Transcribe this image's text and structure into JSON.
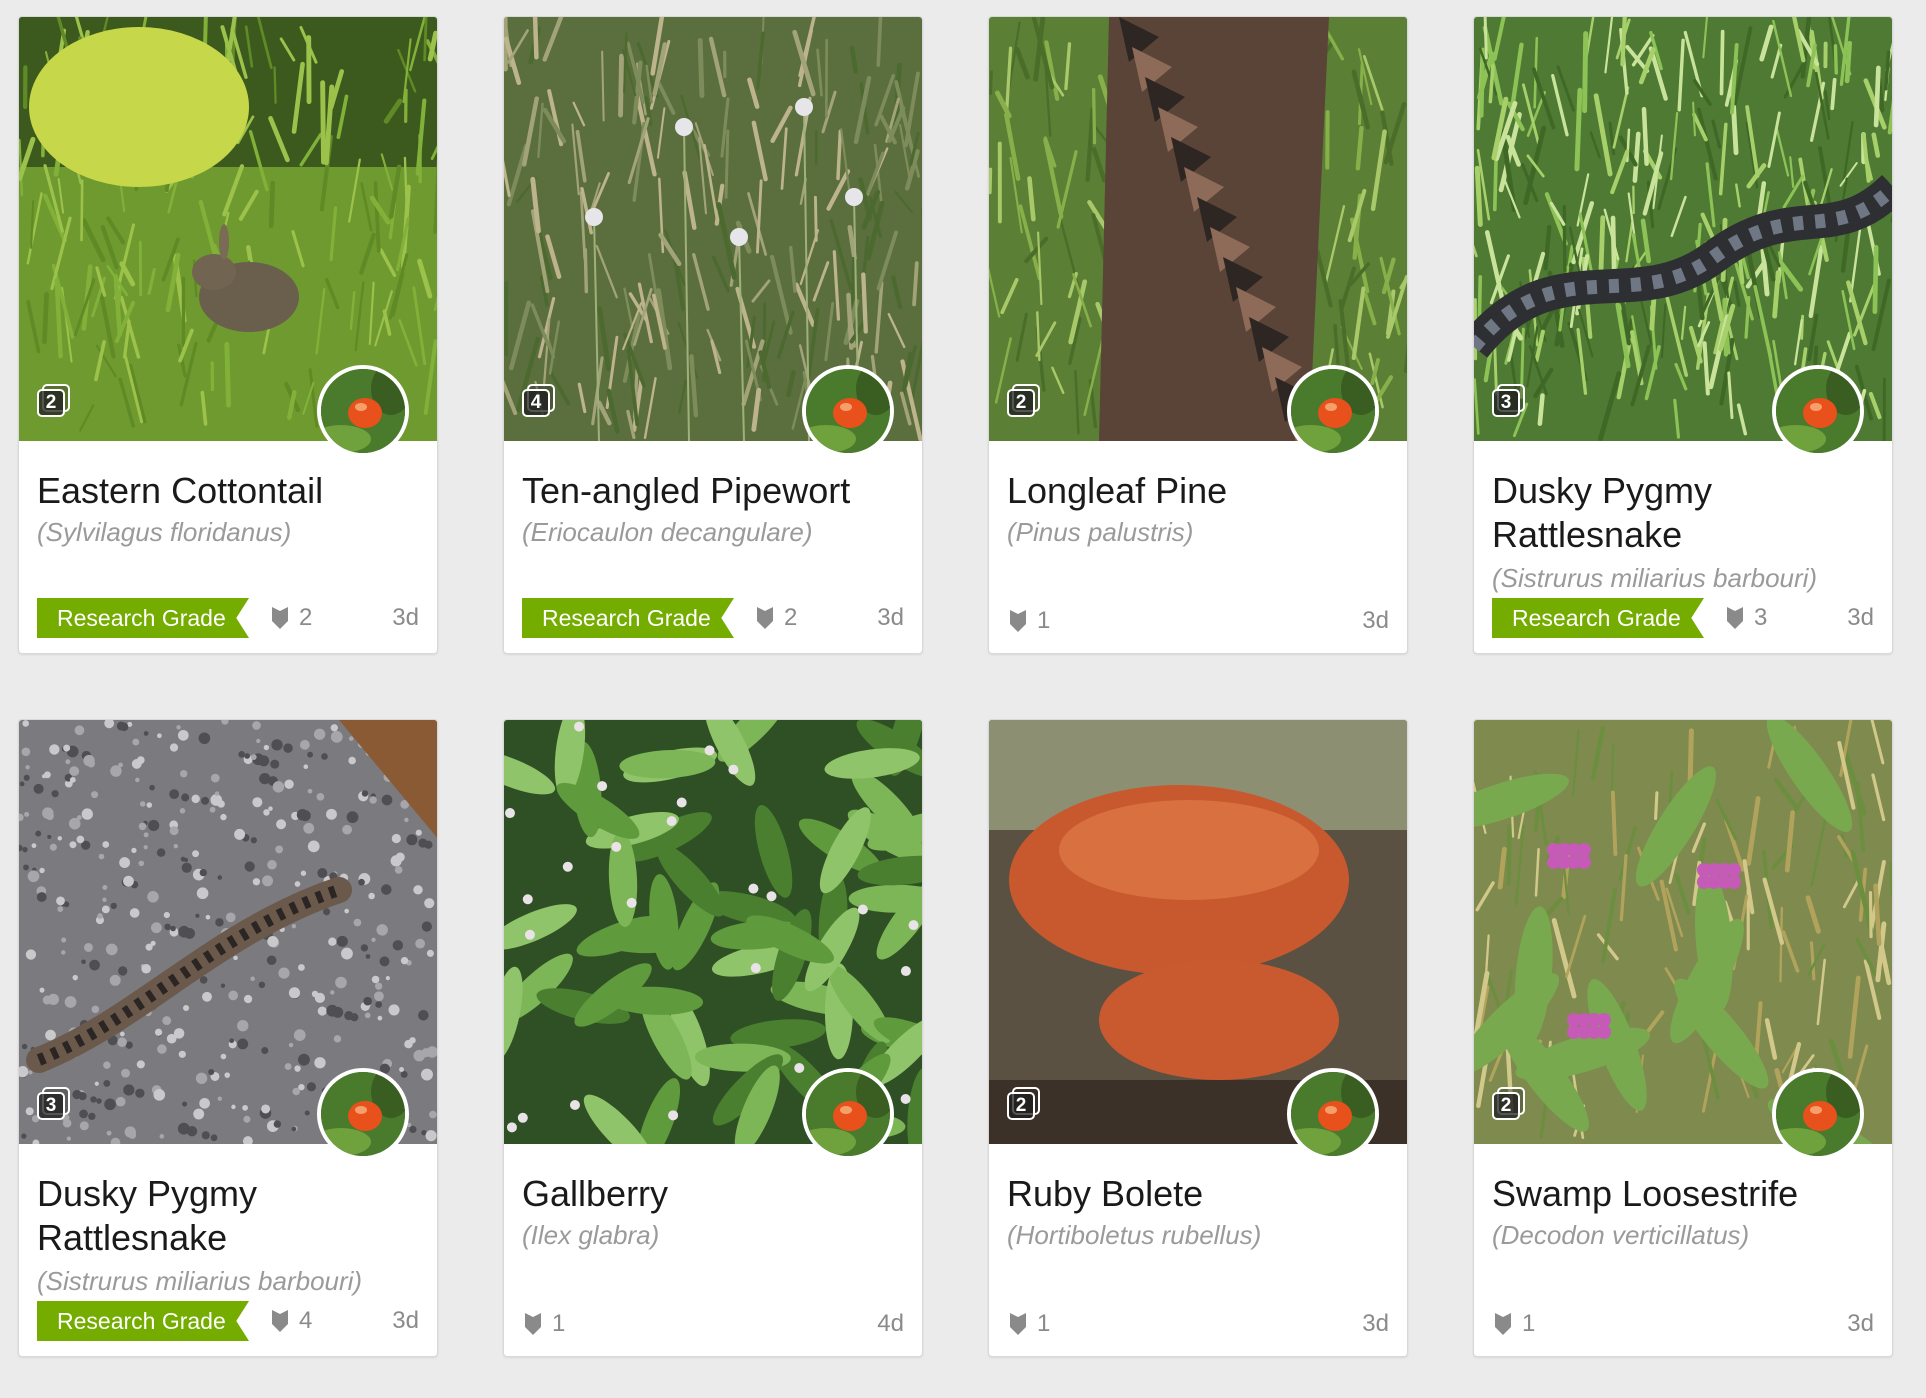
{
  "colors": {
    "research_grade": "#74ac00",
    "background": "#ebebeb",
    "card": "#ffffff"
  },
  "observations": [
    {
      "common_name": "Eastern Cottontail",
      "scientific_name": "(Sylvilagus floridanus)",
      "photo_count": "2",
      "quality_grade": "Research Grade",
      "identifications": "2",
      "age": "3d",
      "photo_subject": "rabbit-on-grass"
    },
    {
      "common_name": "Ten-angled Pipewort",
      "scientific_name": "(Eriocaulon decangulare)",
      "photo_count": "4",
      "quality_grade": "Research Grade",
      "identifications": "2",
      "age": "3d",
      "photo_subject": "pipewort-flowers"
    },
    {
      "common_name": "Longleaf Pine",
      "scientific_name": "(Pinus palustris)",
      "photo_count": "2",
      "quality_grade": "",
      "identifications": "1",
      "age": "3d",
      "photo_subject": "pine-trunk"
    },
    {
      "common_name": "Dusky Pygmy Rattlesnake",
      "scientific_name": "(Sistrurus miliarius barbouri)",
      "photo_count": "3",
      "quality_grade": "Research Grade",
      "identifications": "3",
      "age": "3d",
      "photo_subject": "snake-in-grass"
    },
    {
      "common_name": "Dusky Pygmy Rattlesnake",
      "scientific_name": "(Sistrurus miliarius barbouri)",
      "photo_count": "3",
      "quality_grade": "Research Grade",
      "identifications": "4",
      "age": "3d",
      "photo_subject": "snake-on-asphalt"
    },
    {
      "common_name": "Gallberry",
      "scientific_name": "(Ilex glabra)",
      "photo_count": "",
      "quality_grade": "",
      "identifications": "1",
      "age": "4d",
      "photo_subject": "gallberry-leaves"
    },
    {
      "common_name": "Ruby Bolete",
      "scientific_name": "(Hortiboletus rubellus)",
      "photo_count": "2",
      "quality_grade": "",
      "identifications": "1",
      "age": "3d",
      "photo_subject": "red-mushroom"
    },
    {
      "common_name": "Swamp Loosestrife",
      "scientific_name": "(Decodon verticillatus)",
      "photo_count": "2",
      "quality_grade": "",
      "identifications": "1",
      "age": "3d",
      "photo_subject": "pink-flowers"
    }
  ]
}
